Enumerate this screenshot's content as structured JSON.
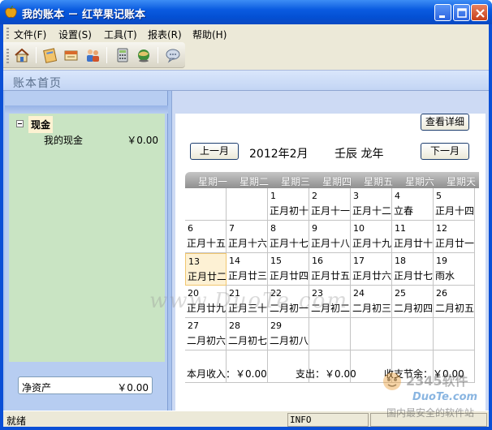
{
  "window": {
    "title": "我的账本 － 红苹果记账本"
  },
  "menu": [
    {
      "label": "文件(F)"
    },
    {
      "label": "设置(S)"
    },
    {
      "label": "工具(T)"
    },
    {
      "label": "报表(R)"
    },
    {
      "label": "帮助(H)"
    }
  ],
  "toolbar_icons": [
    "home-icon",
    "notebook-icon",
    "book-icon",
    "users-icon",
    "calculator-icon",
    "globe-icon",
    "chat-icon"
  ],
  "page_title": "账本首页",
  "accounts": {
    "root_label": "现金",
    "items": [
      {
        "name": "我的现金",
        "amount": "￥0.00"
      }
    ]
  },
  "net_assets": {
    "label": "净资产",
    "value": "￥0.00"
  },
  "calendar": {
    "detail_button": "查看详细",
    "prev_button": "上一月",
    "next_button": "下一月",
    "month_label": "2012年2月",
    "ganzhi": "壬辰 龙年",
    "weekdays": [
      "星期一",
      "星期二",
      "星期三",
      "星期四",
      "星期五",
      "星期六",
      "星期天"
    ],
    "selected_day": "13",
    "rows": [
      [
        {
          "d": "",
          "l": ""
        },
        {
          "d": "",
          "l": ""
        },
        {
          "d": "1",
          "l": "正月初十"
        },
        {
          "d": "2",
          "l": "正月十一"
        },
        {
          "d": "3",
          "l": "正月十二"
        },
        {
          "d": "4",
          "l": "立春"
        },
        {
          "d": "5",
          "l": "正月十四"
        }
      ],
      [
        {
          "d": "6",
          "l": "正月十五"
        },
        {
          "d": "7",
          "l": "正月十六"
        },
        {
          "d": "8",
          "l": "正月十七"
        },
        {
          "d": "9",
          "l": "正月十八"
        },
        {
          "d": "10",
          "l": "正月十九"
        },
        {
          "d": "11",
          "l": "正月廿十"
        },
        {
          "d": "12",
          "l": "正月廿一"
        }
      ],
      [
        {
          "d": "13",
          "l": "正月廿二"
        },
        {
          "d": "14",
          "l": "正月廿三"
        },
        {
          "d": "15",
          "l": "正月廿四"
        },
        {
          "d": "16",
          "l": "正月廿五"
        },
        {
          "d": "17",
          "l": "正月廿六"
        },
        {
          "d": "18",
          "l": "正月廿七"
        },
        {
          "d": "19",
          "l": "雨水"
        }
      ],
      [
        {
          "d": "20",
          "l": "正月廿九"
        },
        {
          "d": "21",
          "l": "正月三十"
        },
        {
          "d": "22",
          "l": "二月初一"
        },
        {
          "d": "23",
          "l": "二月初二"
        },
        {
          "d": "24",
          "l": "二月初三"
        },
        {
          "d": "25",
          "l": "二月初四"
        },
        {
          "d": "26",
          "l": "二月初五"
        }
      ],
      [
        {
          "d": "27",
          "l": "二月初六"
        },
        {
          "d": "28",
          "l": "二月初七"
        },
        {
          "d": "29",
          "l": "二月初八"
        },
        {
          "d": "",
          "l": ""
        },
        {
          "d": "",
          "l": ""
        },
        {
          "d": "",
          "l": ""
        },
        {
          "d": "",
          "l": ""
        }
      ],
      [
        {
          "d": "",
          "l": ""
        },
        {
          "d": "",
          "l": ""
        },
        {
          "d": "",
          "l": ""
        },
        {
          "d": "",
          "l": ""
        },
        {
          "d": "",
          "l": ""
        },
        {
          "d": "",
          "l": ""
        },
        {
          "d": "",
          "l": ""
        }
      ]
    ]
  },
  "summary": {
    "income": "本月收入：￥0.00",
    "expense": "支出：￥0.00",
    "balance": "收支节余：￥0.00"
  },
  "status": {
    "left": "就绪",
    "middle": "INFO"
  },
  "watermark": {
    "url_text": "www.DuoTe.com",
    "brand": "2345软件",
    "site": "DuoTe.com",
    "slogan": "国内最安全的软件站"
  }
}
